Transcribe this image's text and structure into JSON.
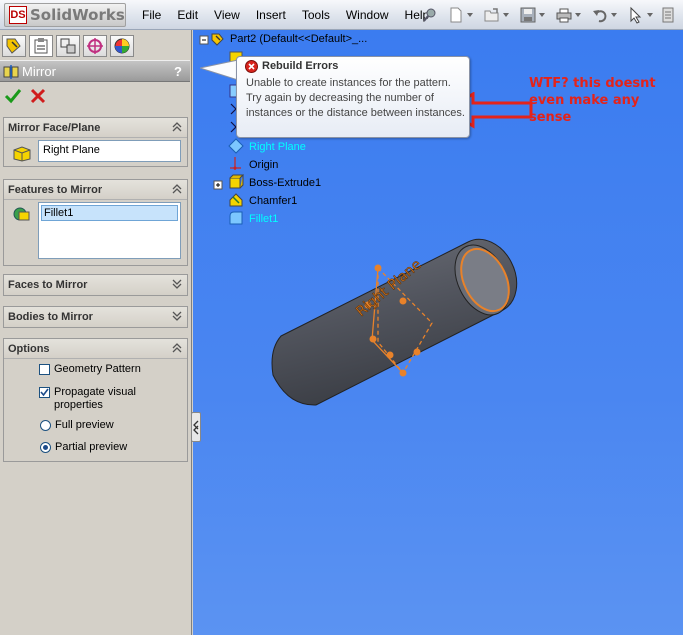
{
  "app": {
    "logo_text": "SolidWorks",
    "logo_badge": "DS"
  },
  "menu": {
    "items": [
      "File",
      "Edit",
      "View",
      "Insert",
      "Tools",
      "Window",
      "Help"
    ]
  },
  "property_manager": {
    "title": "Mirror",
    "help_label": "?",
    "groups": {
      "mirror_face": {
        "title": "Mirror Face/Plane",
        "value": "Right Plane"
      },
      "features": {
        "title": "Features to Mirror",
        "items": [
          "Fillet1"
        ]
      },
      "faces": {
        "title": "Faces to Mirror"
      },
      "bodies": {
        "title": "Bodies to Mirror"
      },
      "options": {
        "title": "Options",
        "geometry_pattern": "Geometry Pattern",
        "propagate_line1": "Propagate visual",
        "propagate_line2": "properties",
        "full_preview": "Full preview",
        "partial_preview": "Partial preview"
      }
    }
  },
  "feature_tree": {
    "root": "Part2  (Default<<Default>_...",
    "items": {
      "right_plane": "Right Plane",
      "origin": "Origin",
      "boss_extrude": "Boss-Extrude1",
      "chamfer": "Chamfer1",
      "fillet": "Fillet1"
    }
  },
  "tooltip": {
    "title": "Rebuild Errors",
    "message": "Unable to create instances for the pattern. Try again by decreasing the number of instances or the distance between instances."
  },
  "annotation": {
    "text": "WTF? this doesnt even make any sense"
  },
  "model": {
    "plane_label": "Right Plane"
  },
  "colors": {
    "viewport_bg": "#3b7cf0",
    "annotation_red": "#e4231a",
    "plane_orange": "#e8822a",
    "tree_highlight": "#00ffff"
  }
}
